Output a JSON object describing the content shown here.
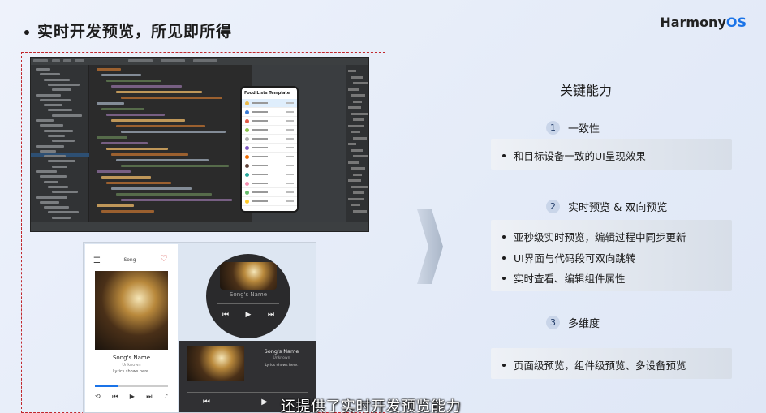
{
  "slide": {
    "title": "实时开发预览，所见即所得",
    "brand_main": "Harmony",
    "brand_os": "OS"
  },
  "ide": {
    "phone_title": "Food Lists Template"
  },
  "music": {
    "header": "Song",
    "song_name": "Song's Name",
    "artist": "Unknown",
    "lyrics": "Lyrics shows here.",
    "watch_song_name": "Song's Name",
    "tablet_song_name": "Song's Name",
    "tablet_artist": "Unknown",
    "tablet_lyrics": "Lyrics shows here."
  },
  "panel": {
    "title": "关键能力",
    "features": [
      {
        "num": "1",
        "label": "一致性",
        "items": [
          "和目标设备一致的UI呈现效果"
        ]
      },
      {
        "num": "2",
        "label": "实时预览 & 双向预览",
        "items": [
          "亚秒级实时预览，编辑过程中同步更新",
          "UI界面与代码段可双向跳转",
          "实时查看、编辑组件属性"
        ]
      },
      {
        "num": "3",
        "label": "多维度",
        "items": [
          "页面级预览，组件级预览、多设备预览"
        ]
      }
    ]
  },
  "caption": "还提供了实时开发预览能力",
  "colors": {
    "accent": "#1a73e8",
    "dashed_border": "#c1272d",
    "badge_bg": "#c9d5e9"
  }
}
